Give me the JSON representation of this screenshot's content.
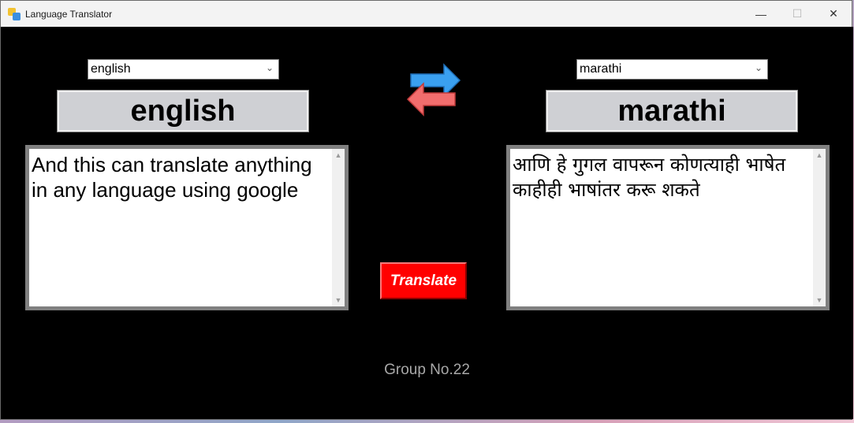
{
  "window": {
    "title": "Language Translator",
    "controls": {
      "minimize": "—",
      "maximize": "☐",
      "close": "✕"
    }
  },
  "source": {
    "dropdown_value": "english",
    "label": "english",
    "text": "And this can translate anything in any language using google"
  },
  "target": {
    "dropdown_value": "marathi",
    "label": "marathi",
    "text": "आणि हे गुगल वापरून कोणत्याही भाषेत काहीही भाषांतर करू शकते"
  },
  "actions": {
    "translate_label": "Translate",
    "swap_icon": "swap-arrows-icon"
  },
  "footer": {
    "text": "Group No.22"
  },
  "colors": {
    "background": "#000000",
    "translate_button": "#ff0000",
    "label_box": "#cfd0d4",
    "footer_text": "#a8a8a8"
  }
}
